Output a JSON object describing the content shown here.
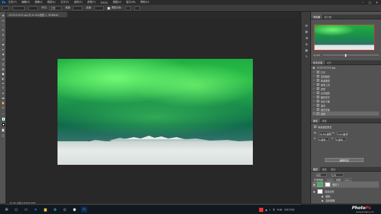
{
  "app": {
    "logo": "Ps"
  },
  "menu": [
    "文件(F)",
    "编辑(E)",
    "图像(I)",
    "图层(L)",
    "文字(Y)",
    "选择(S)",
    "滤镜(T)",
    "3D(D)",
    "视图(V)",
    "窗口(W)",
    "帮助(H)"
  ],
  "window_controls": [
    "–",
    "□",
    "✕"
  ],
  "options": {
    "style_label": "样式:",
    "style_value": "正常",
    "width_label": "宽度:",
    "height_label": "高度:",
    "refine_label": "调整边缘..."
  },
  "document": {
    "tab_title": "1515151515.jpg @ 41.8%(图层 1, RGB/8#)",
    "status_zoom": "41.8%",
    "status_doc": "文档:2.81M/5.63M"
  },
  "navigator": {
    "tabs": [
      "导航器",
      "直方图"
    ],
    "zoom": "41.8%"
  },
  "history": {
    "tabs": [
      "历史记录",
      "动作"
    ],
    "items": [
      "1515151515.jpg",
      "打开",
      "复制图层",
      "新建图层",
      "画笔工具",
      "滤镜",
      "合并图层",
      "图层样式",
      "色彩平衡",
      "曲线",
      "图层蒙版",
      "变换"
    ]
  },
  "properties": {
    "tabs": [
      "属性",
      "调整"
    ],
    "title": "像素图层属性",
    "w_label": "W:",
    "w_value": "13.46 厘米",
    "h_label": "H:",
    "h_value": "7.54 厘米",
    "x_label": "X:",
    "x_value": "0 厘米",
    "y_label": "Y:",
    "y_value": "0 厘米",
    "button": "编辑内容"
  },
  "layers": {
    "tabs": [
      "图层",
      "通道",
      "路径"
    ],
    "kind_label": "类型",
    "blend": "正常",
    "opacity_label": "不透明度:",
    "opacity": "100%",
    "fill_label": "填充:",
    "fill": "100%",
    "items": [
      {
        "name": "图层 1",
        "selected": true
      },
      {
        "name": "智能滤镜",
        "selected": false
      },
      {
        "name": "模糊",
        "selected": false
      },
      {
        "name": "高斯模糊",
        "selected": false
      },
      {
        "name": "背景",
        "selected": false
      }
    ]
  },
  "taskbar": {
    "clock": "9:40",
    "date": "2017/3/2",
    "lang": "中"
  },
  "watermark": {
    "brand_white": "Photo",
    "brand_red": "Ps",
    "url": "www.photops.com"
  }
}
